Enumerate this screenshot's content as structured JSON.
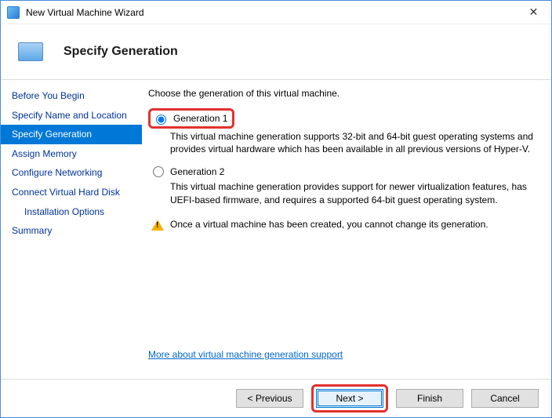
{
  "window": {
    "title": "New Virtual Machine Wizard"
  },
  "header": {
    "title": "Specify Generation"
  },
  "sidebar": {
    "items": [
      {
        "label": "Before You Begin",
        "active": false,
        "indent": false
      },
      {
        "label": "Specify Name and Location",
        "active": false,
        "indent": false
      },
      {
        "label": "Specify Generation",
        "active": true,
        "indent": false
      },
      {
        "label": "Assign Memory",
        "active": false,
        "indent": false
      },
      {
        "label": "Configure Networking",
        "active": false,
        "indent": false
      },
      {
        "label": "Connect Virtual Hard Disk",
        "active": false,
        "indent": false
      },
      {
        "label": "Installation Options",
        "active": false,
        "indent": true
      },
      {
        "label": "Summary",
        "active": false,
        "indent": false
      }
    ]
  },
  "content": {
    "prompt": "Choose the generation of this virtual machine.",
    "gen1": {
      "label": "Generation 1",
      "desc": "This virtual machine generation supports 32-bit and 64-bit guest operating systems and provides virtual hardware which has been available in all previous versions of Hyper-V."
    },
    "gen2": {
      "label": "Generation 2",
      "desc": "This virtual machine generation provides support for newer virtualization features, has UEFI-based firmware, and requires a supported 64-bit guest operating system."
    },
    "warning": "Once a virtual machine has been created, you cannot change its generation.",
    "link": "More about virtual machine generation support"
  },
  "footer": {
    "previous": "< Previous",
    "next": "Next >",
    "finish": "Finish",
    "cancel": "Cancel"
  }
}
